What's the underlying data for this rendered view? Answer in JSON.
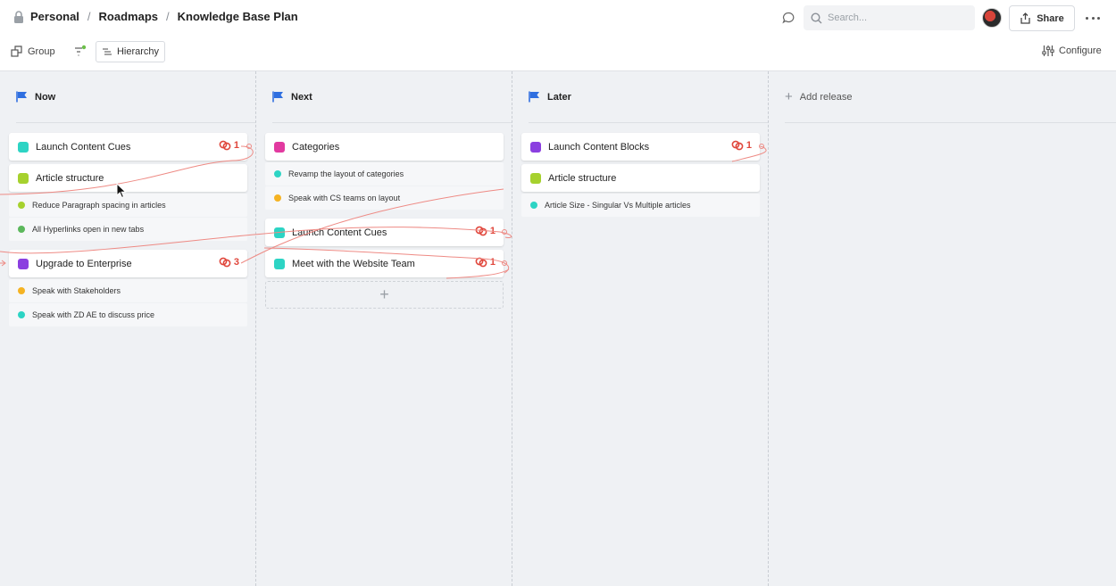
{
  "breadcrumb": {
    "items": [
      "Personal",
      "Roadmaps",
      "Knowledge Base Plan"
    ],
    "separator": "/"
  },
  "search": {
    "placeholder": "Search..."
  },
  "share": {
    "label": "Share"
  },
  "toolbar": {
    "group_label": "Group",
    "hierarchy_label": "Hierarchy",
    "configure_label": "Configure"
  },
  "colors": {
    "accent_flag": "#2f6fe0",
    "link_red": "#e0463b",
    "teal": "#2dd4c4",
    "lime": "#a6d12e",
    "purple": "#8b3fe0",
    "pink": "#e23aa0",
    "orange": "#f5b323",
    "green": "#5cb85c"
  },
  "columns": [
    {
      "title": "Now",
      "items": [
        {
          "kind": "card",
          "label": "Launch Content Cues",
          "color": "teal",
          "links": "1"
        },
        {
          "kind": "card",
          "label": "Article structure",
          "color": "lime"
        },
        {
          "kind": "sub",
          "label": "Reduce Paragraph spacing in articles",
          "color": "lime"
        },
        {
          "kind": "sub",
          "label": "All Hyperlinks open in new tabs",
          "color": "green"
        },
        {
          "kind": "card",
          "label": "Upgrade to Enterprise",
          "color": "purple",
          "links": "3"
        },
        {
          "kind": "sub",
          "label": "Speak with Stakeholders",
          "color": "orange"
        },
        {
          "kind": "sub",
          "label": "Speak with ZD AE to discuss price",
          "color": "teal"
        }
      ]
    },
    {
      "title": "Next",
      "items": [
        {
          "kind": "card",
          "label": "Categories",
          "color": "pink"
        },
        {
          "kind": "sub",
          "label": "Revamp the layout of categories",
          "color": "teal"
        },
        {
          "kind": "sub",
          "label": "Speak with CS teams on layout",
          "color": "orange"
        },
        {
          "kind": "card",
          "label": "Launch Content Cues",
          "color": "teal",
          "links": "1"
        },
        {
          "kind": "card",
          "label": "Meet with the Website Team",
          "color": "teal",
          "links": "1"
        }
      ]
    },
    {
      "title": "Later",
      "items": [
        {
          "kind": "card",
          "label": "Launch Content Blocks",
          "color": "purple",
          "links": "1"
        },
        {
          "kind": "card",
          "label": "Article structure",
          "color": "lime"
        },
        {
          "kind": "sub",
          "label": "Article Size - Singular Vs Multiple articles",
          "color": "teal"
        }
      ]
    }
  ],
  "add_release": {
    "label": "Add release"
  }
}
